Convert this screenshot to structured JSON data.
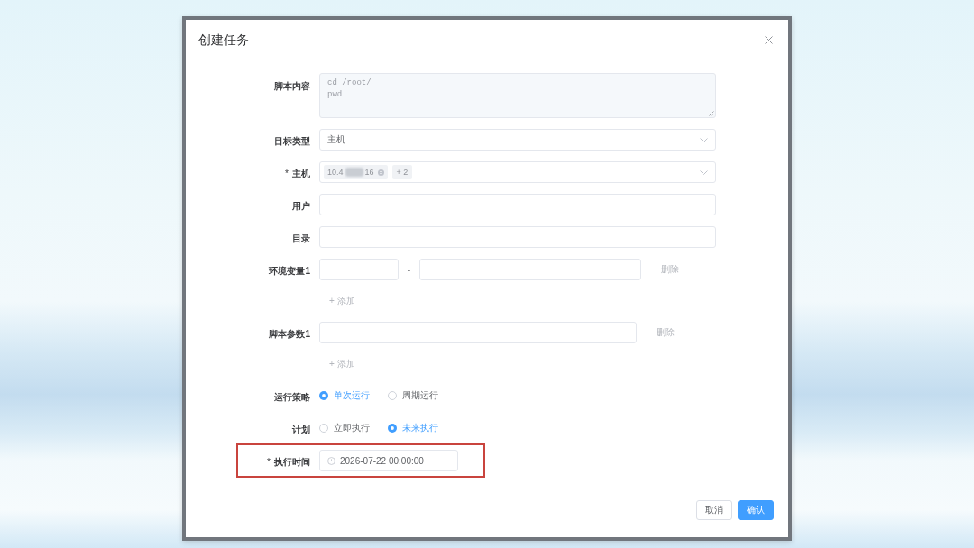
{
  "dialog": {
    "title": "创建任务"
  },
  "form": {
    "required_mark": "*",
    "rows": [
      {
        "kind": "textarea",
        "label": "脚本内容",
        "required": false,
        "lines": [
          "cd /root/",
          "pwd"
        ],
        "disabled": true
      },
      {
        "kind": "select",
        "label": "目标类型",
        "required": false,
        "value": "主机"
      },
      {
        "kind": "tags",
        "label": "主机",
        "required": true,
        "tags": [
          {
            "text_start": "10.4",
            "text_end": "16",
            "redacted": true
          }
        ],
        "more": "+ 2"
      },
      {
        "kind": "input",
        "label": "用户",
        "required": false
      },
      {
        "kind": "input",
        "label": "目录",
        "required": false
      },
      {
        "kind": "pair",
        "label": "环境变量1",
        "required": false,
        "separator": "-",
        "delete": "删除"
      },
      {
        "kind": "add",
        "text": "+ 添加"
      },
      {
        "kind": "input_delete",
        "label": "脚本参数1",
        "required": false,
        "delete": "删除"
      },
      {
        "kind": "add",
        "text": "+ 添加"
      },
      {
        "kind": "radio",
        "label": "运行策略",
        "required": false,
        "options": [
          {
            "label": "单次运行",
            "selected": true
          },
          {
            "label": "周期运行",
            "selected": false
          }
        ]
      },
      {
        "kind": "radio",
        "label": "计划",
        "required": false,
        "options": [
          {
            "label": "立即执行",
            "selected": false
          },
          {
            "label": "未来执行",
            "selected": true
          }
        ]
      },
      {
        "kind": "datetime",
        "label": "执行时间",
        "required": true,
        "value": "2026-07-22 00:00:00",
        "highlighted": true
      }
    ]
  },
  "buttons": [
    {
      "label": "取消",
      "kind": "default"
    },
    {
      "label": "确认",
      "kind": "primary"
    }
  ]
}
